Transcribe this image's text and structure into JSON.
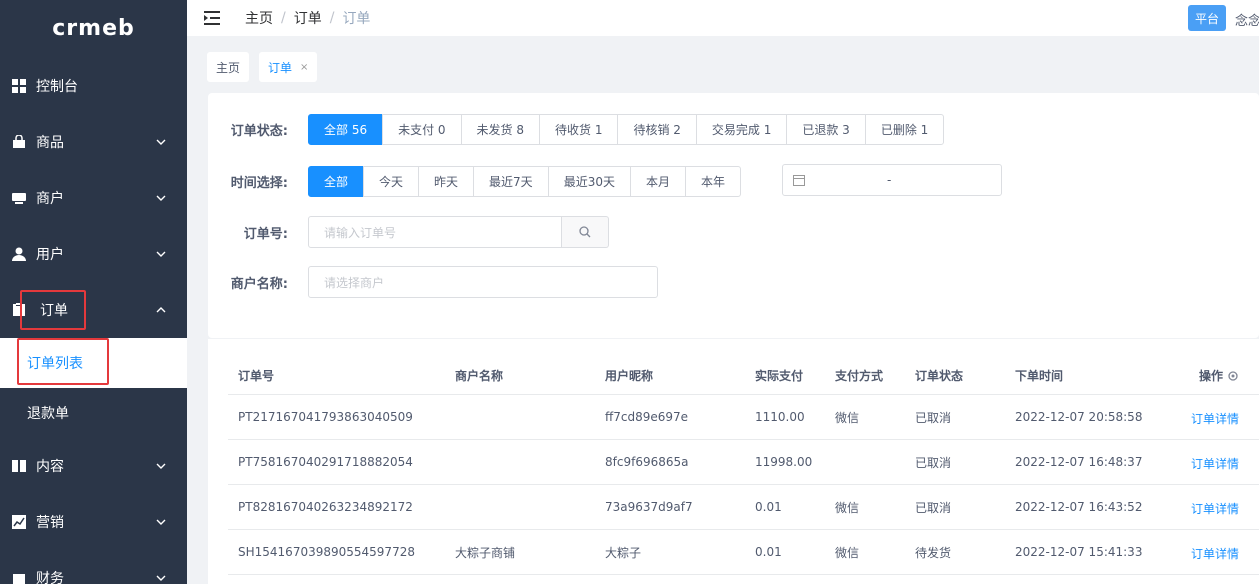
{
  "app": {
    "logo_text": "crmeb"
  },
  "sidebar": {
    "items": [
      {
        "label": "控制台",
        "icon": "dashboard-icon",
        "has_chevron": false
      },
      {
        "label": "商品",
        "icon": "bag-icon",
        "has_chevron": true
      },
      {
        "label": "商户",
        "icon": "shop-icon",
        "has_chevron": true
      },
      {
        "label": "用户",
        "icon": "user-icon",
        "has_chevron": true
      },
      {
        "label": "订单",
        "icon": "order-icon",
        "has_chevron": true,
        "expanded": true
      },
      {
        "label": "内容",
        "icon": "content-icon",
        "has_chevron": true
      },
      {
        "label": "营销",
        "icon": "marketing-icon",
        "has_chevron": true
      },
      {
        "label": "财务",
        "icon": "finance-icon",
        "has_chevron": true
      }
    ],
    "order_submenu": [
      {
        "label": "订单列表",
        "active": true
      },
      {
        "label": "退款单",
        "active": false
      }
    ]
  },
  "header": {
    "breadcrumb": [
      "主页",
      "订单",
      "订单"
    ],
    "platform_button": "平台",
    "username": "念念"
  },
  "tags": [
    {
      "label": "主页",
      "active": false,
      "closable": false
    },
    {
      "label": "订单",
      "active": true,
      "closable": true,
      "close_symbol": "×"
    }
  ],
  "filters": {
    "status_label": "订单状态:",
    "status_options": [
      "全部 56",
      "未支付 0",
      "未发货 8",
      "待收货 1",
      "待核销 2",
      "交易完成 1",
      "已退款 3",
      "已删除 1"
    ],
    "status_selected": 0,
    "time_label": "时间选择:",
    "time_options": [
      "全部",
      "今天",
      "昨天",
      "最近7天",
      "最近30天",
      "本月",
      "本年"
    ],
    "time_selected": 0,
    "date_range_separator": "-",
    "order_no_label": "订单号:",
    "order_no_placeholder": "请输入订单号",
    "merchant_label": "商户名称:",
    "merchant_placeholder": "请选择商户"
  },
  "table": {
    "columns": [
      "订单号",
      "商户名称",
      "用户昵称",
      "实际支付",
      "支付方式",
      "订单状态",
      "下单时间",
      "操作"
    ],
    "rows": [
      {
        "order_no": "PT217167041793863040509",
        "merchant": "",
        "nickname": "ff7cd89e697e",
        "paid": "1110.00",
        "pay_way": "微信",
        "status": "已取消",
        "time": "2022-12-07 20:58:58",
        "action": "订单详情"
      },
      {
        "order_no": "PT758167040291718882054",
        "merchant": "",
        "nickname": "8fc9f696865a",
        "paid": "11998.00",
        "pay_way": "",
        "status": "已取消",
        "time": "2022-12-07 16:48:37",
        "action": "订单详情"
      },
      {
        "order_no": "PT828167040263234892172",
        "merchant": "",
        "nickname": "73a9637d9af7",
        "paid": "0.01",
        "pay_way": "微信",
        "status": "已取消",
        "time": "2022-12-07 16:43:52",
        "action": "订单详情"
      },
      {
        "order_no": "SH154167039890554597728",
        "merchant": "大粽子商铺",
        "nickname": "大粽子",
        "paid": "0.01",
        "pay_way": "微信",
        "status": "待发货",
        "time": "2022-12-07 15:41:33",
        "action": "订单详情"
      }
    ]
  },
  "colors": {
    "sidebar_bg": "#2b3648",
    "primary": "#1890ff",
    "highlight_border": "#e4393c"
  }
}
